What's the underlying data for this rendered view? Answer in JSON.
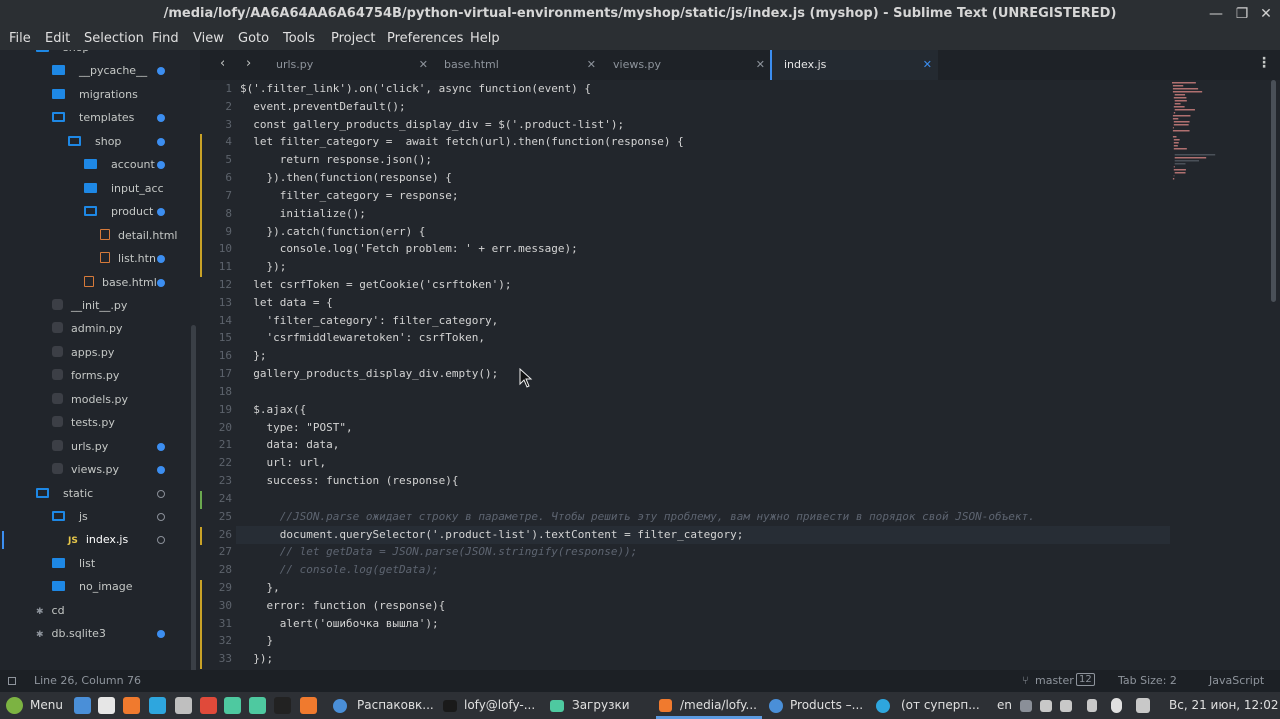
{
  "window": {
    "title": "/media/lofy/AA6A64AA6A64754B/python-virtual-environments/myshop/static/js/index.js (myshop) - Sublime Text (UNREGISTERED)",
    "minimize": "—",
    "maximize": "❐",
    "close": "✕"
  },
  "menu": [
    "File",
    "Edit",
    "Selection",
    "Find",
    "View",
    "Goto",
    "Tools",
    "Project",
    "Preferences",
    "Help"
  ],
  "sidebar": {
    "items": [
      {
        "label": "shop",
        "type": "folder-open",
        "dot": ""
      },
      {
        "label": "__pycache__",
        "type": "folder",
        "dot": "filled"
      },
      {
        "label": "migrations",
        "type": "folder",
        "dot": ""
      },
      {
        "label": "templates",
        "type": "folder-open",
        "dot": "filled"
      },
      {
        "label": "shop",
        "type": "folder-open",
        "dot": "filled"
      },
      {
        "label": "account",
        "type": "folder",
        "dot": "filled"
      },
      {
        "label": "input_acc",
        "type": "folder",
        "dot": ""
      },
      {
        "label": "product",
        "type": "folder-open",
        "dot": "filled"
      },
      {
        "label": "detail.html",
        "type": "html",
        "dot": ""
      },
      {
        "label": "list.htn",
        "type": "html",
        "dot": "filled"
      },
      {
        "label": "base.html",
        "type": "html",
        "dot": "filled"
      },
      {
        "label": "__init__.py",
        "type": "py",
        "dot": ""
      },
      {
        "label": "admin.py",
        "type": "py",
        "dot": ""
      },
      {
        "label": "apps.py",
        "type": "py",
        "dot": ""
      },
      {
        "label": "forms.py",
        "type": "py",
        "dot": ""
      },
      {
        "label": "models.py",
        "type": "py",
        "dot": ""
      },
      {
        "label": "tests.py",
        "type": "py",
        "dot": ""
      },
      {
        "label": "urls.py",
        "type": "py",
        "dot": "filled"
      },
      {
        "label": "views.py",
        "type": "py",
        "dot": "filled"
      },
      {
        "label": "static",
        "type": "folder-open",
        "dot": "hollow"
      },
      {
        "label": "js",
        "type": "folder-open",
        "dot": "hollow"
      },
      {
        "label": "index.js",
        "type": "js",
        "dot": "hollow"
      },
      {
        "label": "list",
        "type": "folder",
        "dot": ""
      },
      {
        "label": "no_image",
        "type": "folder",
        "dot": ""
      },
      {
        "label": "cd",
        "type": "other",
        "dot": ""
      },
      {
        "label": "db.sqlite3",
        "type": "other",
        "dot": "filled"
      }
    ]
  },
  "tabs": [
    {
      "label": "urls.py",
      "close": "✕"
    },
    {
      "label": "base.html",
      "close": "✕"
    },
    {
      "label": "views.py",
      "close": "✕"
    },
    {
      "label": "index.js",
      "close": "✕"
    }
  ],
  "code": [
    "$('.filter_link').on('click', async function(event) {",
    "  event.preventDefault();",
    "  const gallery_products_display_div = $('.product-list');",
    "  let filter_category =  await fetch(url).then(function(response) {",
    "      return response.json();",
    "    }).then(function(response) {",
    "      filter_category = response;",
    "      initialize();",
    "    }).catch(function(err) {",
    "      console.log('Fetch problem: ' + err.message);",
    "    });",
    "  let csrfToken = getCookie('csrftoken');",
    "  let data = {",
    "    'filter_category': filter_category,",
    "    'csrfmiddlewaretoken': csrfToken,",
    "  };",
    "  gallery_products_display_div.empty();",
    "",
    "  $.ajax({",
    "    type: \"POST\",",
    "    data: data,",
    "    url: url,",
    "    success: function (response){",
    "",
    "      //JSON.parse ожидает строку в параметре. Чтобы решить эту проблему, вам нужно привести в порядок свой JSON-объект.",
    "      document.querySelector('.product-list').textContent = filter_category;",
    "      // let getData = JSON.parse(JSON.stringify(response));",
    "      // console.log(getData);",
    "    },",
    "    error: function (response){",
    "      alert('ошибочка вышла');",
    "    }",
    "  });"
  ],
  "status": {
    "position": "Line 26, Column 76",
    "branch": "master",
    "branch_count": "12",
    "tab_size": "Tab Size: 2",
    "syntax": "JavaScript"
  },
  "taskbar": {
    "menu": "Menu",
    "tasks": [
      "Распаковк...",
      "lofy@lofy-...",
      "Загрузки",
      "/media/lofy...",
      "Products –...",
      "(от суперп..."
    ],
    "lang": "en",
    "clock": "Вс, 21 июн, 12:02"
  },
  "colors": {
    "accent": "#3c8ef0",
    "folder": "#1e88e5",
    "bg": "#22262c"
  }
}
